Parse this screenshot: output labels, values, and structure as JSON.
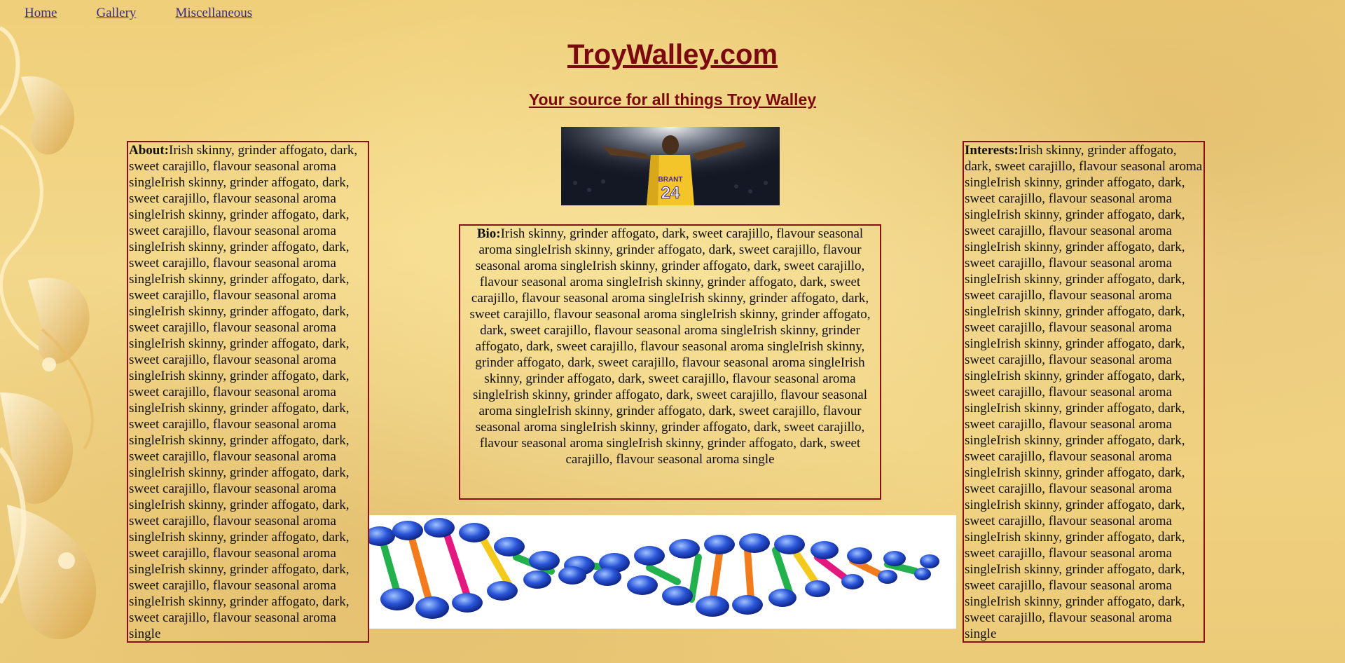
{
  "nav": {
    "items": [
      {
        "label": "Home"
      },
      {
        "label": "Gallery"
      },
      {
        "label": "Miscellaneous"
      }
    ]
  },
  "header": {
    "title": "TroyWalley.com",
    "subtitle": "Your source for all things Troy Walley"
  },
  "about": {
    "label": "About:",
    "text": "Irish skinny, grinder affogato, dark, sweet carajillo, flavour seasonal aroma singleIrish skinny, grinder affogato, dark, sweet carajillo, flavour seasonal aroma singleIrish skinny, grinder affogato, dark, sweet carajillo, flavour seasonal aroma singleIrish skinny, grinder affogato, dark, sweet carajillo, flavour seasonal aroma singleIrish skinny, grinder affogato, dark, sweet carajillo, flavour seasonal aroma singleIrish skinny, grinder affogato, dark, sweet carajillo, flavour seasonal aroma singleIrish skinny, grinder affogato, dark, sweet carajillo, flavour seasonal aroma singleIrish skinny, grinder affogato, dark, sweet carajillo, flavour seasonal aroma singleIrish skinny, grinder affogato, dark, sweet carajillo, flavour seasonal aroma singleIrish skinny, grinder affogato, dark, sweet carajillo, flavour seasonal aroma singleIrish skinny, grinder affogato, dark, sweet carajillo, flavour seasonal aroma singleIrish skinny, grinder affogato, dark, sweet carajillo, flavour seasonal aroma singleIrish skinny, grinder affogato, dark, sweet carajillo, flavour seasonal aroma singleIrish skinny, grinder affogato, dark, sweet carajillo, flavour seasonal aroma singleIrish skinny, grinder affogato, dark, sweet carajillo, flavour seasonal aroma single"
  },
  "bio": {
    "label": "Bio:",
    "text": "Irish skinny, grinder affogato, dark, sweet carajillo, flavour seasonal aroma singleIrish skinny, grinder affogato, dark, sweet carajillo, flavour seasonal aroma singleIrish skinny, grinder affogato, dark, sweet carajillo, flavour seasonal aroma singleIrish skinny, grinder affogato, dark, sweet carajillo, flavour seasonal aroma singleIrish skinny, grinder affogato, dark, sweet carajillo, flavour seasonal aroma singleIrish skinny, grinder affogato, dark, sweet carajillo, flavour seasonal aroma singleIrish skinny, grinder affogato, dark, sweet carajillo, flavour seasonal aroma singleIrish skinny, grinder affogato, dark, sweet carajillo, flavour seasonal aroma singleIrish skinny, grinder affogato, dark, sweet carajillo, flavour seasonal aroma singleIrish skinny, grinder affogato, dark, sweet carajillo, flavour seasonal aroma singleIrish skinny, grinder affogato, dark, sweet carajillo, flavour seasonal aroma singleIrish skinny, grinder affogato, dark, sweet carajillo, flavour seasonal aroma singleIrish skinny, grinder affogato, dark, sweet carajillo, flavour seasonal aroma single"
  },
  "interests": {
    "label": "Interests:",
    "text": "Irish skinny, grinder affogato, dark, sweet carajillo, flavour seasonal aroma singleIrish skinny, grinder affogato, dark, sweet carajillo, flavour seasonal aroma singleIrish skinny, grinder affogato, dark, sweet carajillo, flavour seasonal aroma singleIrish skinny, grinder affogato, dark, sweet carajillo, flavour seasonal aroma singleIrish skinny, grinder affogato, dark, sweet carajillo, flavour seasonal aroma singleIrish skinny, grinder affogato, dark, sweet carajillo, flavour seasonal aroma singleIrish skinny, grinder affogato, dark, sweet carajillo, flavour seasonal aroma singleIrish skinny, grinder affogato, dark, sweet carajillo, flavour seasonal aroma singleIrish skinny, grinder affogato, dark, sweet carajillo, flavour seasonal aroma singleIrish skinny, grinder affogato, dark, sweet carajillo, flavour seasonal aroma singleIrish skinny, grinder affogato, dark, sweet carajillo, flavour seasonal aroma singleIrish skinny, grinder affogato, dark, sweet carajillo, flavour seasonal aroma singleIrish skinny, grinder affogato, dark, sweet carajillo, flavour seasonal aroma singleIrish skinny, grinder affogato, dark, sweet carajillo, flavour seasonal aroma singleIrish skinny, grinder affogato, dark, sweet carajillo, flavour seasonal aroma single"
  },
  "photo": {
    "jersey_name": "BRANT",
    "jersey_number": "24"
  },
  "colors": {
    "heading": "#7a0a10",
    "border": "#8a0f14",
    "link": "#3c2a8a",
    "background": "#f3d78a"
  }
}
